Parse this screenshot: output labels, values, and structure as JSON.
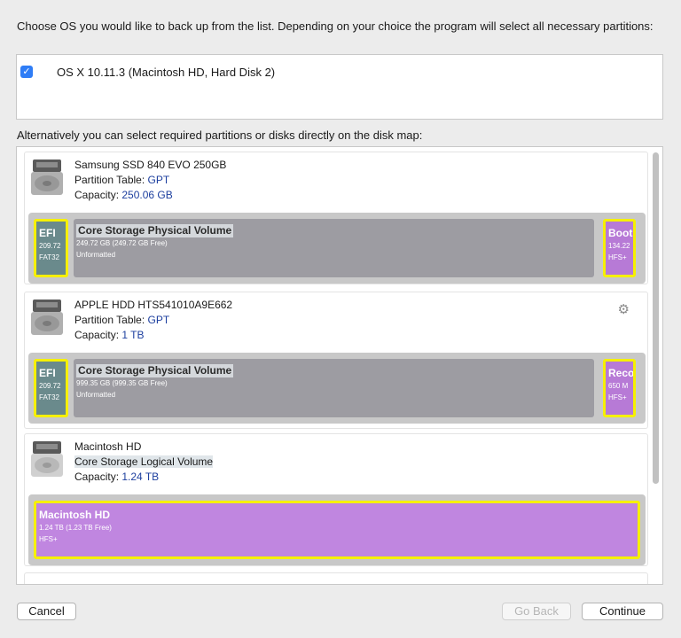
{
  "intro_text": "Choose OS you would like to back up from the list. Depending on your choice the program will select all necessary partitions:",
  "os_list": [
    {
      "checked": true,
      "check_glyph": "✓",
      "label": "OS X 10.11.3 (Macintosh HD, Hard Disk 2)"
    }
  ],
  "alt_text": "Alternatively you can select required partitions or disks directly on the disk map:",
  "disks": [
    {
      "name": "Samsung SSD 840 EVO 250GB",
      "line2_label": "Partition Table: ",
      "line2_value": "GPT",
      "capacity_label": "Capacity: ",
      "capacity_value": "250.06 GB",
      "partitions": [
        {
          "name": "EFI",
          "size": "209.72",
          "fs": "FAT32",
          "selected": true
        },
        {
          "name": "Core Storage Physical Volume",
          "size": "249.72 GB (249.72 GB Free)",
          "fs": "Unformatted",
          "selected": false
        },
        {
          "name": "Boot",
          "size": "134.22",
          "fs": "HFS+",
          "selected": true
        }
      ]
    },
    {
      "name": "APPLE HDD HTS541010A9E662",
      "line2_label": "Partition Table: ",
      "line2_value": "GPT",
      "capacity_label": "Capacity: ",
      "capacity_value": "1 TB",
      "gear_icon": "⚙",
      "partitions": [
        {
          "name": "EFI",
          "size": "209.72",
          "fs": "FAT32",
          "selected": true
        },
        {
          "name": "Core Storage Physical Volume",
          "size": "999.35 GB (999.35 GB Free)",
          "fs": "Unformatted",
          "selected": false
        },
        {
          "name": "Reco",
          "size": "650 M",
          "fs": "HFS+",
          "selected": true
        }
      ]
    },
    {
      "name": "Macintosh HD",
      "line2_text": "Core Storage Logical Volume",
      "capacity_label": "Capacity: ",
      "capacity_value": "1.24 TB",
      "partitions": [
        {
          "name": "Macintosh HD",
          "size": "1.24 TB (1.23 TB Free)",
          "fs": "HFS+",
          "selected": true
        }
      ]
    }
  ],
  "buttons": {
    "cancel": "Cancel",
    "back": "Go Back",
    "continue": "Continue"
  },
  "colors": {
    "efi": "#6a8a8c",
    "core": "#9d9ca2",
    "hfs": "#b77ad6",
    "selection": "#f6f000",
    "value_text": "#1d3f9f"
  }
}
